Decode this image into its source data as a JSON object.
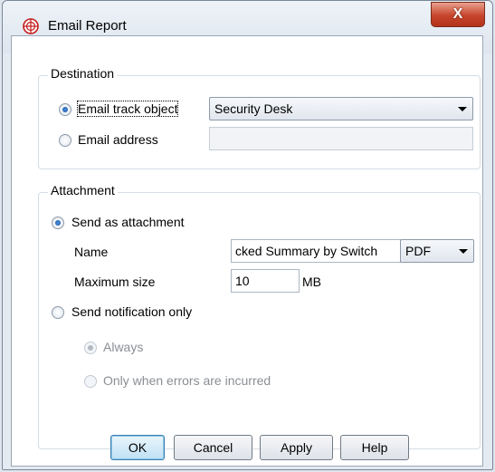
{
  "window": {
    "title": "Email Report",
    "close_label": "X"
  },
  "destination": {
    "group_label": "Destination",
    "email_track_object_label": "Email track object",
    "email_track_object_value": "Security Desk",
    "email_address_label": "Email address",
    "email_address_value": ""
  },
  "attachment": {
    "group_label": "Attachment",
    "send_as_attachment_label": "Send as attachment",
    "name_label": "Name",
    "name_value": "cked Summary by Switch",
    "format_value": "PDF",
    "max_size_label": "Maximum size",
    "max_size_value": "10",
    "max_size_unit": "MB",
    "send_notification_only_label": "Send notification only",
    "always_label": "Always",
    "only_errors_label": "Only when errors are incurred"
  },
  "buttons": {
    "ok": "OK",
    "cancel": "Cancel",
    "apply": "Apply",
    "help": "Help"
  },
  "colors": {
    "close_button": "#c6452c",
    "default_button_border": "#3c7fb1",
    "radio_checked": "#1c4f9c"
  }
}
